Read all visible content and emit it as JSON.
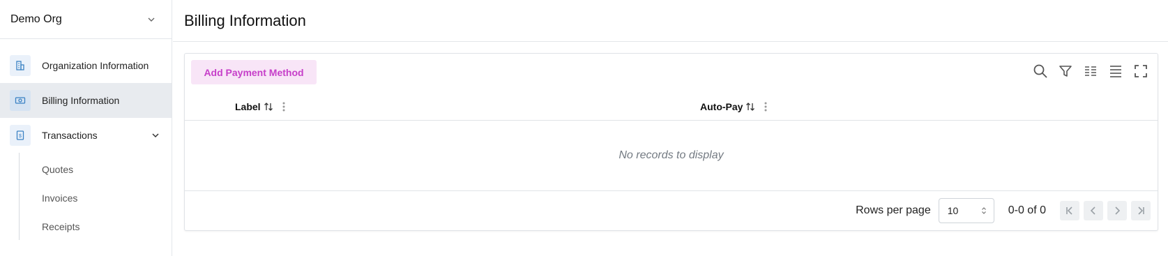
{
  "sidebar": {
    "org_name": "Demo Org",
    "items": [
      {
        "label": "Organization Information",
        "icon": "building-icon",
        "active": false
      },
      {
        "label": "Billing Information",
        "icon": "money-icon",
        "active": true
      },
      {
        "label": "Transactions",
        "icon": "receipt-icon",
        "active": false,
        "expanded": true
      }
    ],
    "subitems": [
      "Quotes",
      "Invoices",
      "Receipts"
    ]
  },
  "header": {
    "title": "Billing Information"
  },
  "table": {
    "add_button_label": "Add Payment Method",
    "columns": [
      {
        "label": "Label"
      },
      {
        "label": "Auto-Pay"
      }
    ],
    "empty_text": "No records to display",
    "toolbar_icons": [
      "search-icon",
      "filter-icon",
      "columns-icon",
      "density-icon",
      "fullscreen-icon"
    ]
  },
  "pagination": {
    "rows_per_page_label": "Rows per page",
    "rows_per_page_value": "10",
    "range_text": "0-0 of 0"
  },
  "colors": {
    "accent_text": "#c63fc9",
    "accent_bg": "#f8e5f7",
    "nav_icon": "#3b82c4",
    "active_bg": "#e8ebef"
  }
}
